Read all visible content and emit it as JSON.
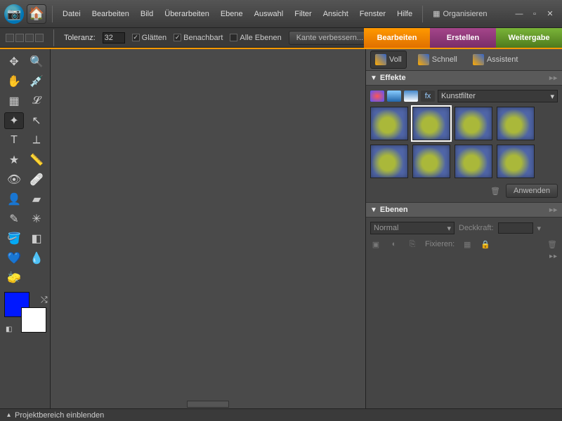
{
  "menubar": {
    "items": [
      "Datei",
      "Bearbeiten",
      "Bild",
      "Überarbeiten",
      "Ebene",
      "Auswahl",
      "Filter",
      "Ansicht",
      "Fenster",
      "Hilfe"
    ],
    "organize": "Organisieren"
  },
  "optionbar": {
    "tolerance_label": "Toleranz:",
    "tolerance_value": "32",
    "smooth": "Glätten",
    "contig": "Benachbart",
    "all_layers": "Alle Ebenen",
    "refine": "Kante verbessern..."
  },
  "modes": {
    "edit": "Bearbeiten",
    "create": "Erstellen",
    "share": "Weitergabe"
  },
  "tools": [
    {
      "n": "move",
      "g": "✥"
    },
    {
      "n": "zoom",
      "g": "🔍"
    },
    {
      "n": "hand",
      "g": "✋"
    },
    {
      "n": "eyedrop",
      "g": "💉"
    },
    {
      "n": "marquee",
      "g": "▦"
    },
    {
      "n": "lasso",
      "g": "𝓛"
    },
    {
      "n": "wand",
      "g": "✦",
      "active": true
    },
    {
      "n": "quick-sel",
      "g": "↖"
    },
    {
      "n": "type",
      "g": "T"
    },
    {
      "n": "crop",
      "g": "⟂"
    },
    {
      "n": "cookie",
      "g": "★"
    },
    {
      "n": "straighten",
      "g": "📏"
    },
    {
      "n": "redeye",
      "g": "👁"
    },
    {
      "n": "heal",
      "g": "🩹"
    },
    {
      "n": "clone",
      "g": "👤"
    },
    {
      "n": "eraser",
      "g": "▰"
    },
    {
      "n": "brush",
      "g": "✎"
    },
    {
      "n": "smart",
      "g": "✳"
    },
    {
      "n": "bucket",
      "g": "🪣"
    },
    {
      "n": "gradient",
      "g": "◧"
    },
    {
      "n": "shape",
      "g": "💙"
    },
    {
      "n": "blur",
      "g": "💧"
    },
    {
      "n": "sponge",
      "g": "🧽"
    },
    {
      "n": "",
      "g": ""
    }
  ],
  "panel_tabs": {
    "full": "Voll",
    "quick": "Schnell",
    "guided": "Assistent"
  },
  "effects": {
    "title": "Effekte",
    "category": "Kunstfilter",
    "apply": "Anwenden"
  },
  "layers": {
    "title": "Ebenen",
    "blend": "Normal",
    "opacity_label": "Deckkraft:",
    "lock_label": "Fixieren:"
  },
  "statusbar": {
    "text": "Projektbereich einblenden"
  }
}
